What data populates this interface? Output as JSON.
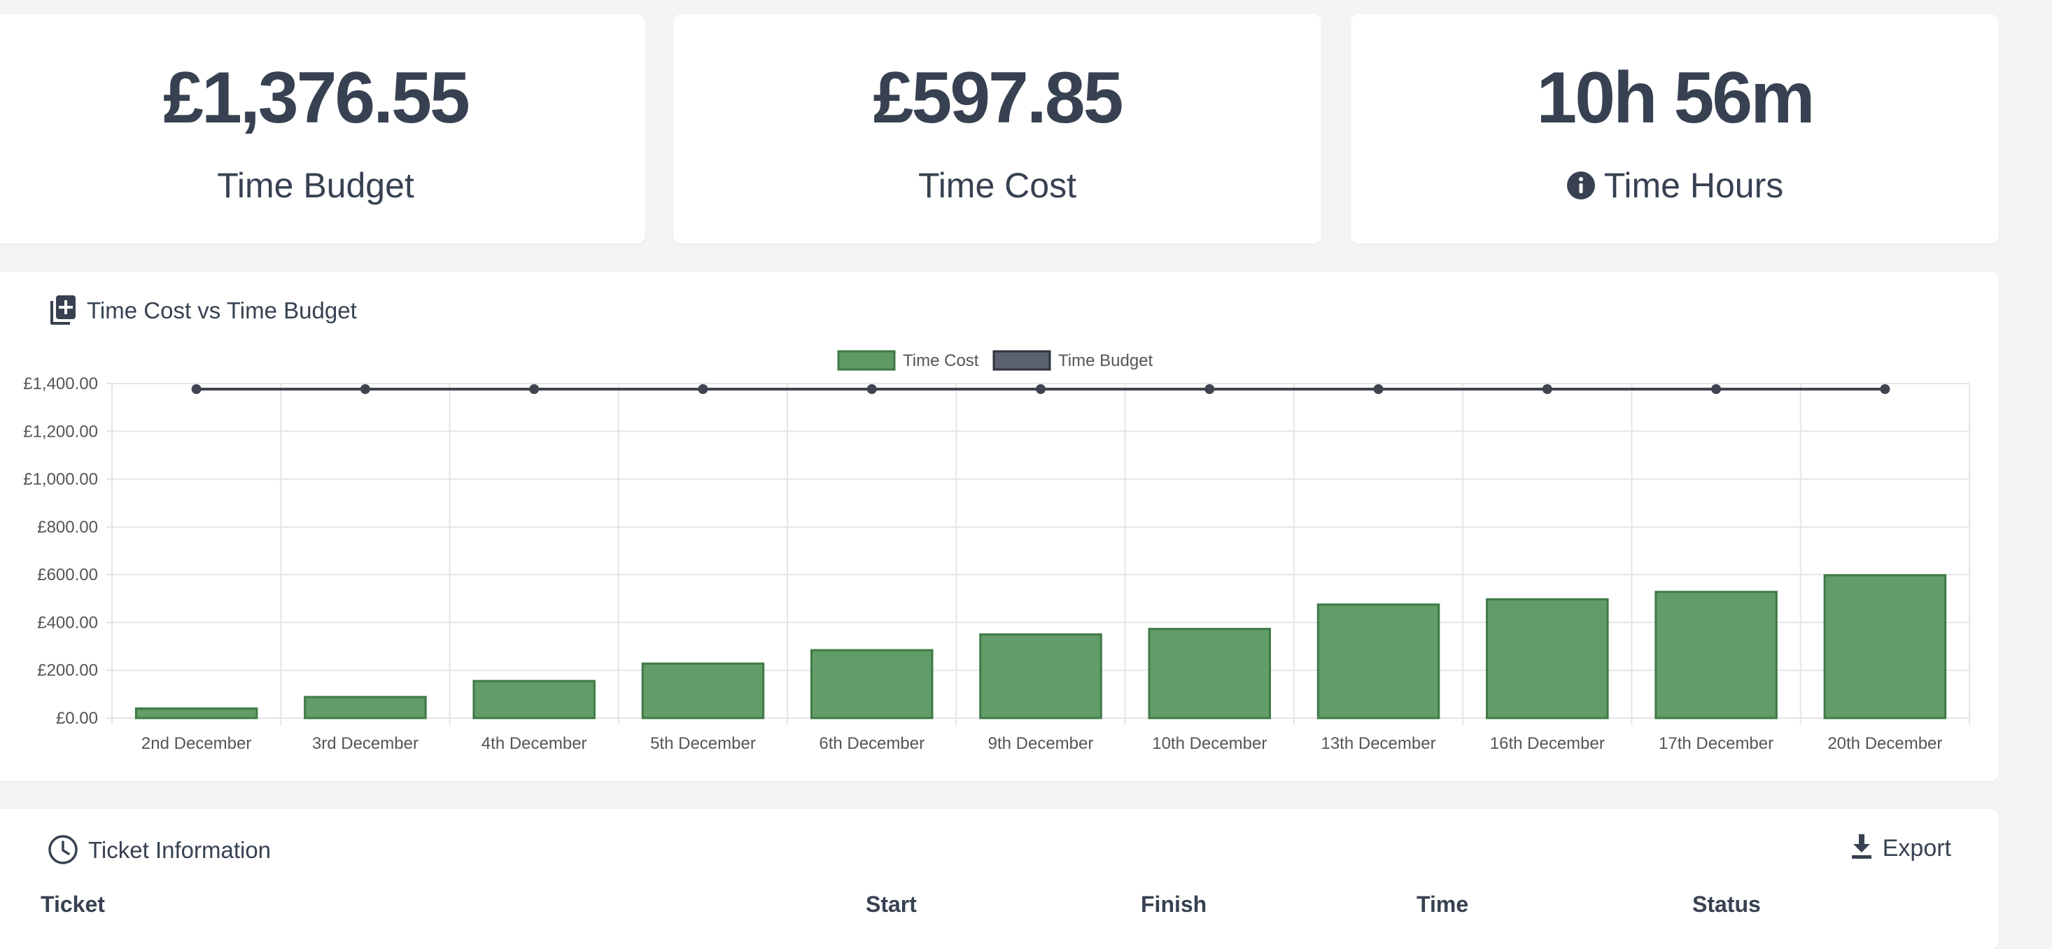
{
  "stats": [
    {
      "value": "£1,376.55",
      "label": "Time Budget"
    },
    {
      "value": "£597.85",
      "label": "Time Cost"
    },
    {
      "value": "10h 56m",
      "label": "Time Hours",
      "icon": "info-icon"
    }
  ],
  "chart_card": {
    "title": "Time Cost vs Time Budget",
    "icon": "file-plus-icon"
  },
  "chart_data": {
    "type": "bar",
    "categories": [
      "2nd December",
      "3rd December",
      "4th December",
      "5th December",
      "6th December",
      "9th December",
      "10th December",
      "13th December",
      "16th December",
      "17th December",
      "20th December"
    ],
    "series": [
      {
        "name": "Time Cost",
        "type": "bar",
        "color": "#5f9a65",
        "values": [
          40,
          88,
          155,
          228,
          284,
          350,
          373,
          475,
          497,
          528,
          597.85
        ]
      },
      {
        "name": "Time Budget",
        "type": "line",
        "color": "#3f4450",
        "values": [
          1376.55,
          1376.55,
          1376.55,
          1376.55,
          1376.55,
          1376.55,
          1376.55,
          1376.55,
          1376.55,
          1376.55,
          1376.55
        ]
      }
    ],
    "y_ticks": [
      "£0.00",
      "£200.00",
      "£400.00",
      "£600.00",
      "£800.00",
      "£1,000.00",
      "£1,200.00",
      "£1,400.00"
    ],
    "ylim": [
      0,
      1400
    ],
    "grid": true,
    "legend_position": "top-center",
    "title": "",
    "xlabel": "",
    "ylabel": ""
  },
  "ticket_card": {
    "title": "Ticket Information",
    "icon": "clock-icon",
    "export_label": "Export",
    "export_icon": "download-icon",
    "columns": [
      "Ticket",
      "Start",
      "Finish",
      "Time",
      "Status"
    ]
  }
}
